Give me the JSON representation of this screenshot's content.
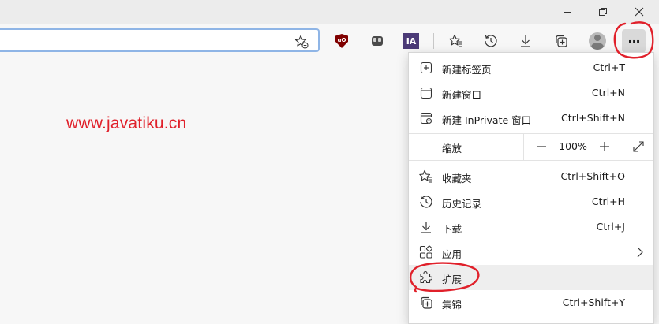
{
  "titlebar": {
    "minimize_icon": "minimize-icon",
    "restore_icon": "restore-icon",
    "close_icon": "close-icon"
  },
  "toolbar": {
    "address_value": "",
    "favorite_icon": "star-add-icon",
    "extensions": [
      {
        "name": "ublock-icon",
        "text": "uO"
      },
      {
        "name": "extension-gray-icon",
        "text": ""
      },
      {
        "name": "ia-icon",
        "text": "IA"
      }
    ],
    "more_label": "···"
  },
  "watermark": "www.javatiku.cn",
  "menu": {
    "items_top": [
      {
        "label": "新建标签页",
        "shortcut": "Ctrl+T",
        "icon": "new-tab-icon"
      },
      {
        "label": "新建窗口",
        "shortcut": "Ctrl+N",
        "icon": "new-window-icon"
      },
      {
        "label": "新建 InPrivate 窗口",
        "shortcut": "Ctrl+Shift+N",
        "icon": "inprivate-icon"
      }
    ],
    "zoom": {
      "label": "缩放",
      "value": "100%",
      "minus": "—",
      "plus": "+"
    },
    "items_bottom": [
      {
        "label": "收藏夹",
        "shortcut": "Ctrl+Shift+O",
        "icon": "favorites-icon"
      },
      {
        "label": "历史记录",
        "shortcut": "Ctrl+H",
        "icon": "history-icon"
      },
      {
        "label": "下载",
        "shortcut": "Ctrl+J",
        "icon": "download-icon"
      },
      {
        "label": "应用",
        "shortcut": "",
        "icon": "apps-icon"
      },
      {
        "label": "扩展",
        "shortcut": "",
        "icon": "extensions-icon"
      },
      {
        "label": "集锦",
        "shortcut": "Ctrl+Shift+Y",
        "icon": "collections-icon"
      }
    ]
  },
  "colors": {
    "accent": "#8fb5e6",
    "annotation": "#e0202a",
    "menu_bg": "#ffffff",
    "highlight": "#eeeeee"
  }
}
